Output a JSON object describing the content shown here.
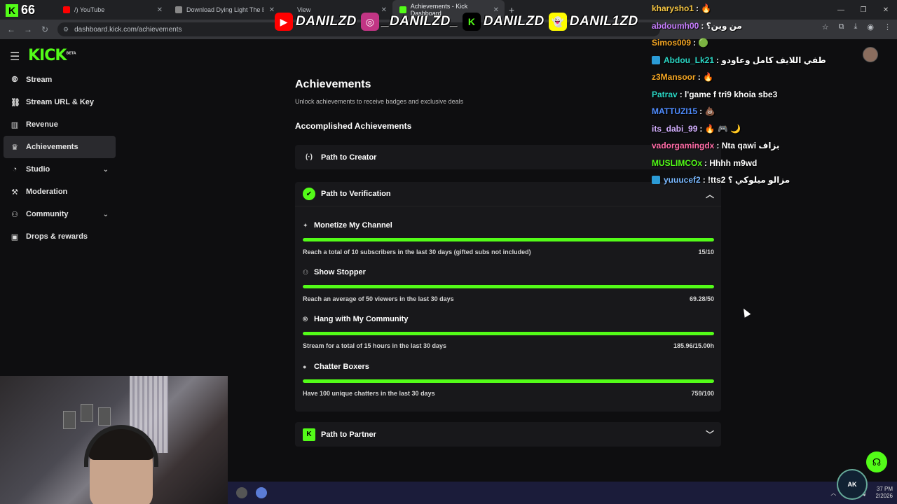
{
  "browser": {
    "tabs": [
      {
        "label": "/) YouTube",
        "favicon_color": "#ff0000"
      },
      {
        "label": "Download Dying Light The Beast",
        "favicon_color": "#888888"
      },
      {
        "label": "View",
        "favicon_color": "#888888"
      },
      {
        "label": "Achievements - Kick Dashboard",
        "favicon_color": "#53fc18",
        "active": true
      }
    ],
    "url": "dashboard.kick.com/achievements"
  },
  "overlay": {
    "viewer_count": "66",
    "socials": [
      {
        "icon": "youtube-icon",
        "color": "#ff0000",
        "name": "DANILZD"
      },
      {
        "icon": "instagram-icon",
        "color": "#c13584",
        "name": "_DANILZD_"
      },
      {
        "icon": "kick-icon",
        "color": "#53fc18",
        "name": "DANILZD"
      },
      {
        "icon": "snapchat-icon",
        "color": "#fffc00",
        "name": "DANIL1ZD"
      }
    ],
    "chat": [
      {
        "user": "kharysho1",
        "text": ": 🔥",
        "color": "#f5c542",
        "badge": false
      },
      {
        "user": "abdoumh00",
        "text": ": من وين؟",
        "color": "#c77dff",
        "badge": false
      },
      {
        "user": "Simos009",
        "text": ": 🟢",
        "color": "#f5a623",
        "badge": false
      },
      {
        "user": "Abdou_Lk21",
        "text": ": طفي اللايف كامل وعاودو",
        "color": "#2bd6c4",
        "badge": true
      },
      {
        "user": "z3Mansoor",
        "text": ": 🔥",
        "color": "#f5a623",
        "badge": false
      },
      {
        "user": "Patrav",
        "text": ": l'game f tri9 khoia sbe3",
        "color": "#2bd6c4",
        "badge": false
      },
      {
        "user": "MATTUZI15",
        "text": ": 💩",
        "color": "#4f8cff",
        "badge": false
      },
      {
        "user": "its_dabi_99",
        "text": ": 🔥 🎮 🌙",
        "color": "#d4b0ff",
        "badge": false
      },
      {
        "user": "vadorgamingdx",
        "text": ": Nta qawi بزاف",
        "color": "#ff6ba6",
        "badge": false
      },
      {
        "user": "MUSLIMCOx",
        "text": ": Hhhh m9wd",
        "color": "#53fc18",
        "badge": false
      },
      {
        "user": "yuuucef2",
        "text": ": !tts2 مزالو ميلوكي ؟",
        "color": "#7ab8ff",
        "badge": true
      }
    ]
  },
  "sidebar": {
    "items": [
      {
        "label": "Stream",
        "icon": "broadcast-icon",
        "glyph": "((·))"
      },
      {
        "label": "Stream URL & Key",
        "icon": "link-icon",
        "glyph": "⛓"
      },
      {
        "label": "Revenue",
        "icon": "chart-icon",
        "glyph": "▥"
      },
      {
        "label": "Achievements",
        "icon": "trophy-icon",
        "glyph": "🏆",
        "active": true
      },
      {
        "label": "Studio",
        "icon": "studio-icon",
        "glyph": "◔",
        "chevron": true
      },
      {
        "label": "Moderation",
        "icon": "hammer-icon",
        "glyph": "🔨"
      },
      {
        "label": "Community",
        "icon": "community-icon",
        "glyph": "⚇",
        "chevron": true
      },
      {
        "label": "Drops & rewards",
        "icon": "gift-icon",
        "glyph": "🎁"
      }
    ]
  },
  "page": {
    "title": "Achievements",
    "subtitle": "Unlock achievements to receive badges and exclusive deals",
    "section_title": "Accomplished Achievements",
    "path_creator": "Path to Creator",
    "path_verification": "Path to Verification",
    "path_partner": "Path to Partner",
    "achievements": [
      {
        "title": "Monetize My Channel",
        "icon": "sparkle-icon",
        "glyph": "✦",
        "desc": "Reach a total of 10 subscribers in the last 30 days (gifted subs not included)",
        "progress": "15/10",
        "fill": 1.0
      },
      {
        "title": "Show Stopper",
        "icon": "viewers-icon",
        "glyph": "⚇",
        "desc": "Reach an average of 50 viewers in the last 30 days",
        "progress": "69.28/50",
        "fill": 1.0
      },
      {
        "title": "Hang with My Community",
        "icon": "broadcast-icon",
        "glyph": "((·))",
        "desc": "Stream for a total of 15 hours in the last 30 days",
        "progress": "185.96/15.00h",
        "fill": 1.0
      },
      {
        "title": "Chatter Boxers",
        "icon": "chat-icon",
        "glyph": "●",
        "desc": "Have 100 unique chatters in the last 30 days",
        "progress": "759/100",
        "fill": 1.0
      }
    ]
  },
  "taskbar": {
    "time": "37 PM",
    "date": "2/2026"
  },
  "watermark": "AK"
}
